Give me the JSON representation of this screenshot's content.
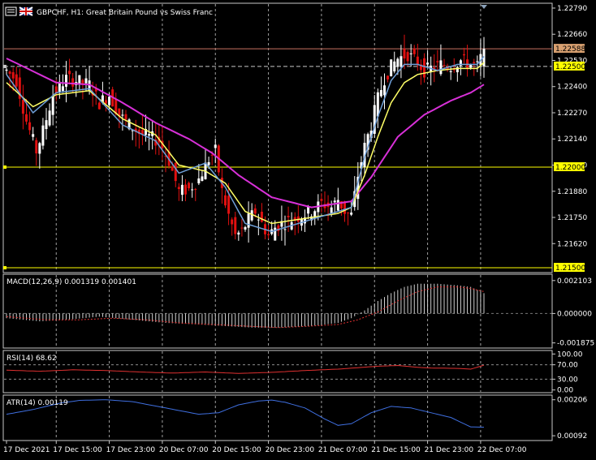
{
  "window": {
    "symbol_title": "GBPCHF, H1:  Great Britain Pound vs Swiss Franc"
  },
  "colors": {
    "background": "#000000",
    "grid": "#c8c8c8",
    "bull": "#ffffff",
    "bear": "#e01010",
    "ma_fast": "#ffff66",
    "ma_mid": "#6f9fd8",
    "ma_slow": "#d830d8",
    "macd_signal": "#e03030",
    "rsi": "#e03030",
    "atr": "#3f6fe0",
    "level": "#ffff00",
    "bid_line": "#c87060",
    "bid_box": "#d8a070"
  },
  "main_panel": {
    "price_labels": [
      "1.22790",
      "1.22660",
      "1.22530",
      "1.22400",
      "1.22270",
      "1.22140",
      "1.22010",
      "1.21880",
      "1.21750",
      "1.21620"
    ],
    "price_values": [
      1.2279,
      1.2266,
      1.2253,
      1.224,
      1.2227,
      1.2214,
      1.2201,
      1.2188,
      1.2175,
      1.2162
    ],
    "ylim": [
      1.2148,
      1.2281
    ],
    "current_price_label": "1.22588",
    "current_price": 1.22588,
    "levels": [
      {
        "label": "1.22500",
        "value": 1.225
      },
      {
        "label": "1.22000",
        "value": 1.22
      },
      {
        "label": "1.21500",
        "value": 1.215
      }
    ]
  },
  "macd_panel": {
    "title": "MACD(12,26,9) 0.001319 0.001401",
    "scale_labels": [
      "0.002103",
      "0.000000",
      "-0.001875"
    ],
    "scale_values": [
      0.002103,
      0,
      -0.001875
    ],
    "ylim": [
      -0.0021,
      0.0023
    ]
  },
  "rsi_panel": {
    "title": "RSI(14) 68.62",
    "scale_labels": [
      "100.00",
      "70.00",
      "30.00",
      "0.00"
    ],
    "scale_values": [
      100,
      70,
      30,
      0
    ],
    "ylim": [
      -3,
      103
    ]
  },
  "atr_panel": {
    "title": "ATR(14) 0.00119",
    "scale_labels": [
      "0.00206",
      "0.00092"
    ],
    "scale_values": [
      0.00206,
      0.00092
    ],
    "ylim": [
      0.00082,
      0.00213
    ]
  },
  "time_axis": {
    "labels": [
      "17 Dec 2021",
      "17 Dec 15:00",
      "17 Dec 23:00",
      "20 Dec 07:00",
      "20 Dec 15:00",
      "20 Dec 23:00",
      "21 Dec 07:00",
      "21 Dec 15:00",
      "21 Dec 23:00",
      "22 Dec 07:00"
    ],
    "bar_index": [
      0,
      15,
      31,
      47,
      63,
      79,
      95,
      111,
      127,
      143
    ]
  },
  "chart_data": {
    "type": "candlestick",
    "symbol": "GBPCHF",
    "timeframe": "H1",
    "anchors": {
      "close": [
        [
          0,
          1.2248
        ],
        [
          3,
          1.2243
        ],
        [
          6,
          1.2223
        ],
        [
          9,
          1.2208
        ],
        [
          11,
          1.2218
        ],
        [
          14,
          1.2236
        ],
        [
          18,
          1.2244
        ],
        [
          21,
          1.2243
        ],
        [
          25,
          1.2241
        ],
        [
          28,
          1.2232
        ],
        [
          31,
          1.2236
        ],
        [
          34,
          1.2226
        ],
        [
          37,
          1.2221
        ],
        [
          40,
          1.2217
        ],
        [
          43,
          1.2215
        ],
        [
          46,
          1.2213
        ],
        [
          49,
          1.2203
        ],
        [
          52,
          1.2188
        ],
        [
          55,
          1.2189
        ],
        [
          58,
          1.2194
        ],
        [
          61,
          1.2204
        ],
        [
          63,
          1.2208
        ],
        [
          65,
          1.2188
        ],
        [
          67,
          1.2176
        ],
        [
          69,
          1.2166
        ],
        [
          71,
          1.2168
        ],
        [
          73,
          1.2174
        ],
        [
          75,
          1.2178
        ],
        [
          77,
          1.2172
        ],
        [
          79,
          1.2166
        ],
        [
          81,
          1.217
        ],
        [
          83,
          1.2172
        ],
        [
          86,
          1.2174
        ],
        [
          89,
          1.2176
        ],
        [
          92,
          1.2178
        ],
        [
          95,
          1.2182
        ],
        [
          98,
          1.218
        ],
        [
          100,
          1.2184
        ],
        [
          102,
          1.2178
        ],
        [
          104,
          1.2176
        ],
        [
          106,
          1.2196
        ],
        [
          108,
          1.221
        ],
        [
          110,
          1.2221
        ],
        [
          112,
          1.2234
        ],
        [
          114,
          1.2244
        ],
        [
          116,
          1.225
        ],
        [
          118,
          1.2254
        ],
        [
          121,
          1.2256
        ],
        [
          124,
          1.2252
        ],
        [
          126,
          1.2248
        ],
        [
          128,
          1.2249
        ],
        [
          131,
          1.2251
        ],
        [
          134,
          1.225
        ],
        [
          137,
          1.2253
        ],
        [
          140,
          1.2251
        ],
        [
          142,
          1.225
        ],
        [
          144,
          1.22588
        ]
      ],
      "ma_fast": [
        [
          0,
          1.2242
        ],
        [
          8,
          1.223
        ],
        [
          15,
          1.2236
        ],
        [
          25,
          1.2238
        ],
        [
          35,
          1.2224
        ],
        [
          45,
          1.2216
        ],
        [
          52,
          1.2201
        ],
        [
          60,
          1.2198
        ],
        [
          66,
          1.2192
        ],
        [
          72,
          1.2178
        ],
        [
          80,
          1.2172
        ],
        [
          92,
          1.2175
        ],
        [
          100,
          1.2177
        ],
        [
          104,
          1.218
        ],
        [
          108,
          1.2196
        ],
        [
          112,
          1.2215
        ],
        [
          116,
          1.2232
        ],
        [
          120,
          1.2242
        ],
        [
          124,
          1.2246
        ],
        [
          130,
          1.2248
        ],
        [
          136,
          1.2249
        ],
        [
          142,
          1.2249
        ],
        [
          144,
          1.2252
        ]
      ],
      "ma_mid": [
        [
          0,
          1.2246
        ],
        [
          8,
          1.2227
        ],
        [
          15,
          1.2237
        ],
        [
          25,
          1.2239
        ],
        [
          35,
          1.2221
        ],
        [
          45,
          1.2213
        ],
        [
          52,
          1.2197
        ],
        [
          60,
          1.2202
        ],
        [
          66,
          1.219
        ],
        [
          72,
          1.2172
        ],
        [
          80,
          1.2168
        ],
        [
          92,
          1.2174
        ],
        [
          100,
          1.2178
        ],
        [
          104,
          1.218
        ],
        [
          108,
          1.2205
        ],
        [
          112,
          1.2225
        ],
        [
          116,
          1.2243
        ],
        [
          120,
          1.2251
        ],
        [
          124,
          1.2251
        ],
        [
          130,
          1.2248
        ],
        [
          136,
          1.2251
        ],
        [
          142,
          1.2251
        ],
        [
          144,
          1.2255
        ]
      ],
      "ma_slow": [
        [
          0,
          1.2254
        ],
        [
          15,
          1.2242
        ],
        [
          25,
          1.2241
        ],
        [
          35,
          1.2232
        ],
        [
          45,
          1.2222
        ],
        [
          55,
          1.2214
        ],
        [
          62,
          1.2207
        ],
        [
          70,
          1.2196
        ],
        [
          80,
          1.2185
        ],
        [
          92,
          1.218
        ],
        [
          104,
          1.2183
        ],
        [
          110,
          1.2195
        ],
        [
          118,
          1.2215
        ],
        [
          126,
          1.2226
        ],
        [
          134,
          1.2233
        ],
        [
          140,
          1.2237
        ],
        [
          144,
          1.2241
        ]
      ],
      "macd": [
        [
          0,
          -0.0003
        ],
        [
          10,
          -0.0005
        ],
        [
          18,
          -0.0004
        ],
        [
          28,
          -0.0002
        ],
        [
          38,
          -0.0004
        ],
        [
          48,
          -0.0006
        ],
        [
          58,
          -0.0007
        ],
        [
          66,
          -0.0008
        ],
        [
          74,
          -0.0009
        ],
        [
          82,
          -0.0009
        ],
        [
          92,
          -0.0008
        ],
        [
          100,
          -0.0006
        ],
        [
          104,
          -0.0003
        ],
        [
          108,
          0.0002
        ],
        [
          112,
          0.0008
        ],
        [
          116,
          0.0013
        ],
        [
          120,
          0.0017
        ],
        [
          124,
          0.0019
        ],
        [
          130,
          0.0019
        ],
        [
          136,
          0.0018
        ],
        [
          140,
          0.0017
        ],
        [
          144,
          0.0013
        ]
      ],
      "macd_signal": [
        [
          0,
          -0.0002
        ],
        [
          12,
          -0.0004
        ],
        [
          22,
          -0.0004
        ],
        [
          32,
          -0.0003
        ],
        [
          42,
          -0.0004
        ],
        [
          52,
          -0.0006
        ],
        [
          62,
          -0.0007
        ],
        [
          72,
          -0.0008
        ],
        [
          82,
          -0.0009
        ],
        [
          92,
          -0.0008
        ],
        [
          100,
          -0.0007
        ],
        [
          106,
          -0.0004
        ],
        [
          112,
          0.0001
        ],
        [
          118,
          0.0008
        ],
        [
          124,
          0.0014
        ],
        [
          130,
          0.0017
        ],
        [
          136,
          0.0017
        ],
        [
          140,
          0.0016
        ],
        [
          144,
          0.0014
        ]
      ],
      "rsi": [
        [
          0,
          55
        ],
        [
          10,
          52
        ],
        [
          20,
          56
        ],
        [
          30,
          54
        ],
        [
          40,
          50
        ],
        [
          50,
          47
        ],
        [
          60,
          50
        ],
        [
          70,
          46
        ],
        [
          80,
          49
        ],
        [
          90,
          54
        ],
        [
          100,
          58
        ],
        [
          106,
          62
        ],
        [
          112,
          66
        ],
        [
          118,
          68
        ],
        [
          124,
          63
        ],
        [
          128,
          61
        ],
        [
          136,
          60
        ],
        [
          140,
          58
        ],
        [
          144,
          68.62
        ]
      ],
      "atr": [
        [
          0,
          0.0016
        ],
        [
          8,
          0.00175
        ],
        [
          16,
          0.00195
        ],
        [
          22,
          0.00204
        ],
        [
          30,
          0.00206
        ],
        [
          38,
          0.002
        ],
        [
          48,
          0.0018
        ],
        [
          58,
          0.0016
        ],
        [
          64,
          0.00165
        ],
        [
          70,
          0.0019
        ],
        [
          76,
          0.00202
        ],
        [
          80,
          0.00205
        ],
        [
          84,
          0.00198
        ],
        [
          90,
          0.0018
        ],
        [
          96,
          0.00145
        ],
        [
          100,
          0.00125
        ],
        [
          104,
          0.0013
        ],
        [
          110,
          0.00165
        ],
        [
          116,
          0.00185
        ],
        [
          122,
          0.0018
        ],
        [
          128,
          0.00165
        ],
        [
          134,
          0.0015
        ],
        [
          140,
          0.0012
        ],
        [
          144,
          0.00119
        ]
      ]
    }
  }
}
